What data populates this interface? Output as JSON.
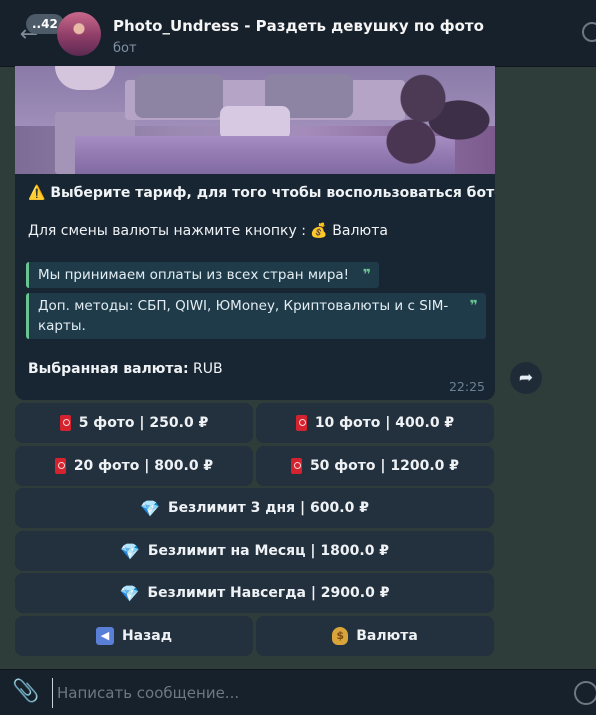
{
  "header": {
    "unread_count": "..42",
    "title": "Photo_Undress - Раздеть девушку по фото",
    "subtitle": "бот"
  },
  "message": {
    "warning_emoji": "⚠️",
    "warning_text": "Выберите тариф, для того чтобы воспользоваться ботом.",
    "currency_hint": "Для смены валюты нажмите кнопку : 💰 Валюта",
    "quote1": "Мы принимаем оплаты из всех стран мира!",
    "quote2": "Доп. методы: СБП, QIWI, ЮMoney, Криптовалюты и с SIM-карты.",
    "quote_mark": "❞",
    "selected_label": "Выбранная валюта:",
    "selected_value": "RUB",
    "time": "22:25"
  },
  "keyboard": {
    "row1": [
      "5 фото | 250.0 ₽",
      "10 фото | 400.0 ₽"
    ],
    "row2": [
      "20 фото | 800.0 ₽",
      "50 фото | 1200.0 ₽"
    ],
    "unlimited_3days": "Безлимит 3 дня | 600.0 ₽",
    "unlimited_month": "Безлимит на Месяц | 1800.0 ₽",
    "unlimited_forever": "Безлимит Навсегда | 2900.0 ₽",
    "back": "Назад",
    "currency": "Валюта"
  },
  "composer": {
    "placeholder": "Написать сообщение..."
  },
  "icons": {
    "back": "arrow-left-icon",
    "attach": "paperclip-icon",
    "emoji": "smile-icon",
    "forward": "forward-arrow-icon",
    "search": "search-icon"
  }
}
